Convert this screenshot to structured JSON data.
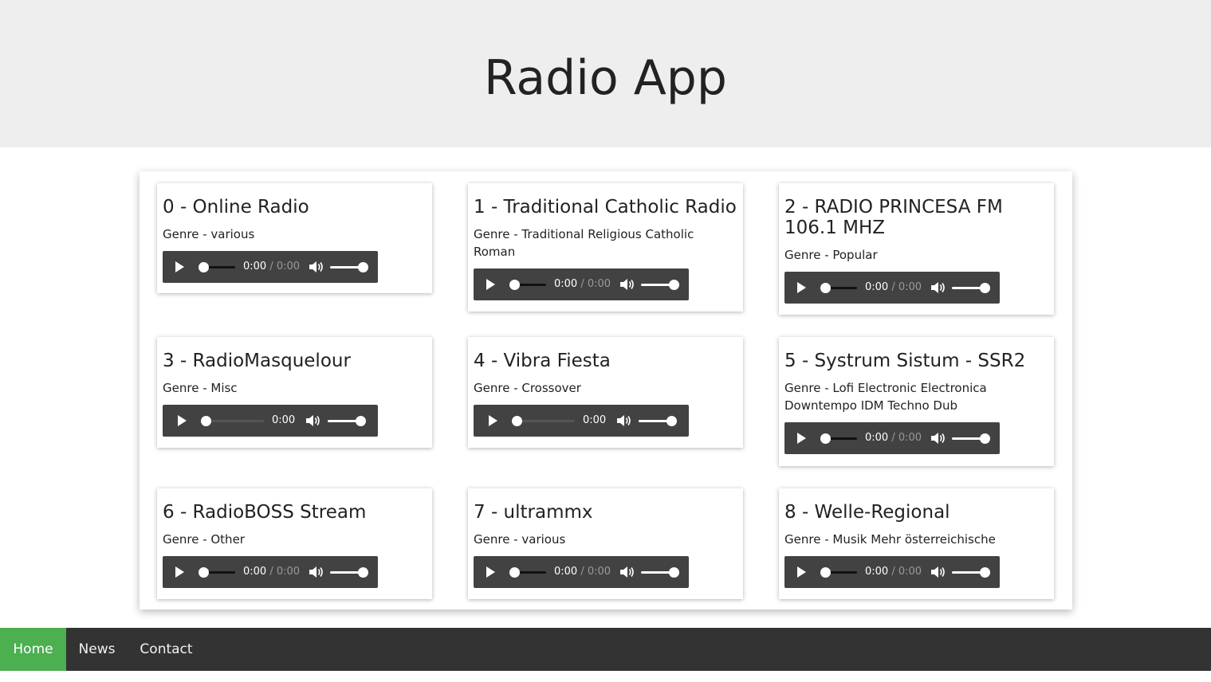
{
  "app": {
    "title": "Radio App"
  },
  "stations": [
    {
      "name": "0 - Online Radio",
      "genre": "Genre - various",
      "player": {
        "current": "0:00",
        "duration": "0:00",
        "live": false
      }
    },
    {
      "name": "1 - Traditional Catholic Radio",
      "genre": "Genre - Traditional Religious Catholic Roman",
      "player": {
        "current": "0:00",
        "duration": "0:00",
        "live": false
      }
    },
    {
      "name": "2 - RADIO PRINCESA FM 106.1 MHZ",
      "genre": "Genre - Popular",
      "player": {
        "current": "0:00",
        "duration": "0:00",
        "live": false
      }
    },
    {
      "name": "3 - RadioMasquelour",
      "genre": "Genre - Misc",
      "player": {
        "current": "0:00",
        "duration": "",
        "live": true
      }
    },
    {
      "name": "4 - Vibra Fiesta",
      "genre": "Genre - Crossover",
      "player": {
        "current": "0:00",
        "duration": "",
        "live": true
      }
    },
    {
      "name": "5 - Systrum Sistum - SSR2",
      "genre": "Genre - Lofi Electronic Electronica Downtempo IDM Techno Dub",
      "player": {
        "current": "0:00",
        "duration": "0:00",
        "live": false
      }
    },
    {
      "name": "6 - RadioBOSS Stream",
      "genre": "Genre - Other",
      "player": {
        "current": "0:00",
        "duration": "0:00",
        "live": false
      }
    },
    {
      "name": "7 - ultrammx",
      "genre": "Genre - various",
      "player": {
        "current": "0:00",
        "duration": "0:00",
        "live": false
      }
    },
    {
      "name": "8 - Welle-Regional",
      "genre": "Genre - Musik Mehr österreichische",
      "player": {
        "current": "0:00",
        "duration": "0:00",
        "live": false
      }
    }
  ],
  "nav": {
    "items": [
      {
        "label": "Home",
        "active": true
      },
      {
        "label": "News",
        "active": false
      },
      {
        "label": "Contact",
        "active": false
      }
    ]
  },
  "colors": {
    "header_bg": "#eeeeee",
    "player_bg": "#424242",
    "nav_bg": "#333333",
    "nav_active": "#4caf50"
  }
}
